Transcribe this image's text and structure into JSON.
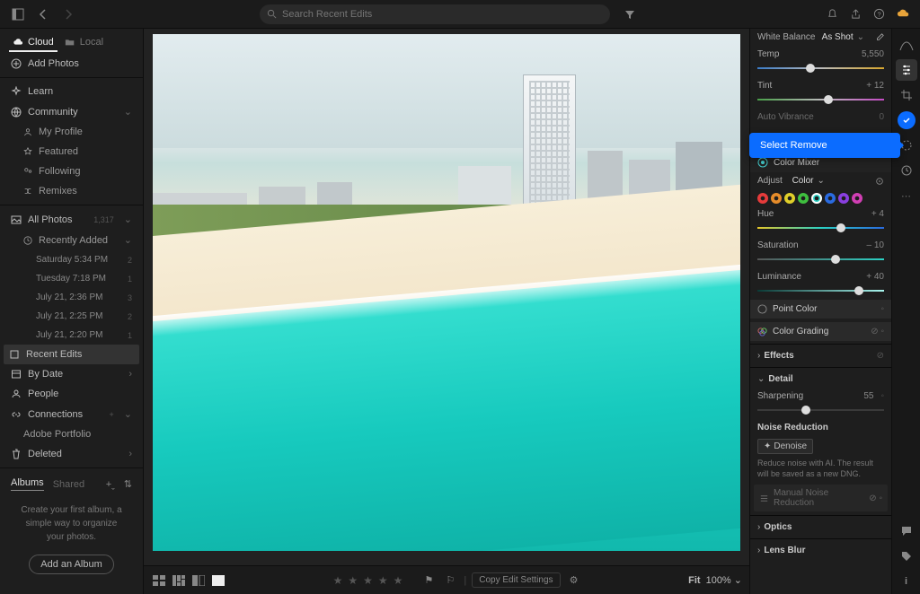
{
  "search": {
    "placeholder": "Search Recent Edits"
  },
  "sidebarTabs": {
    "cloud": "Cloud",
    "local": "Local"
  },
  "addPhotos": "Add Photos",
  "nav": {
    "learn": "Learn",
    "community": "Community",
    "myProfile": "My Profile",
    "featured": "Featured",
    "following": "Following",
    "remixes": "Remixes"
  },
  "photos": {
    "all": "All Photos",
    "allCount": "1,317",
    "recently": "Recently Added",
    "items": [
      {
        "label": "Saturday  5:34 PM",
        "count": "2"
      },
      {
        "label": "Tuesday  7:18 PM",
        "count": "1"
      },
      {
        "label": "July 21, 2:36 PM",
        "count": "3"
      },
      {
        "label": "July 21, 2:25 PM",
        "count": "2"
      },
      {
        "label": "July 21, 2:20 PM",
        "count": "1"
      }
    ],
    "recentEdits": "Recent Edits",
    "byDate": "By Date",
    "people": "People",
    "connections": "Connections",
    "portfolio": "Adobe Portfolio",
    "deleted": "Deleted"
  },
  "albums": {
    "albums": "Albums",
    "shared": "Shared",
    "help": "Create your first album, a simple way to organize your photos.",
    "add": "Add an Album"
  },
  "filmstrip": {
    "copy": "Copy Edit Settings",
    "fit": "Fit",
    "zoom": "100%"
  },
  "callout": "Select Remove",
  "edit": {
    "wb": {
      "label": "White Balance",
      "value": "As Shot"
    },
    "temp": {
      "label": "Temp",
      "value": "5,550",
      "pos": 42
    },
    "tint": {
      "label": "Tint",
      "value": "+ 12",
      "pos": 56
    },
    "autoVibrance": {
      "label": "Auto Vibrance",
      "value": "0",
      "pos": 50
    },
    "colorMixer": "Color Mixer",
    "adjust": {
      "label": "Adjust",
      "value": "Color"
    },
    "swatches": [
      "#e63b3b",
      "#e68c2a",
      "#e0cf2a",
      "#3fbf3f",
      "#2bd1c4",
      "#2a6be0",
      "#8a3fe0",
      "#d13fb4"
    ],
    "swatchSelected": 4,
    "hue": {
      "label": "Hue",
      "value": "+ 4",
      "pos": 66
    },
    "saturation": {
      "label": "Saturation",
      "value": "– 10",
      "pos": 62
    },
    "luminance": {
      "label": "Luminance",
      "value": "+ 40",
      "pos": 80
    },
    "pointColor": "Point Color",
    "colorGrading": "Color Grading",
    "effects": "Effects",
    "detail": "Detail",
    "sharpening": {
      "label": "Sharpening",
      "value": "55",
      "pos": 38
    },
    "noiseReduction": "Noise Reduction",
    "denoise": "Denoise",
    "noiseHelp": "Reduce noise with AI. The result will be saved as a new DNG.",
    "manualNR": "Manual Noise Reduction",
    "optics": "Optics",
    "lensBlur": "Lens Blur"
  }
}
